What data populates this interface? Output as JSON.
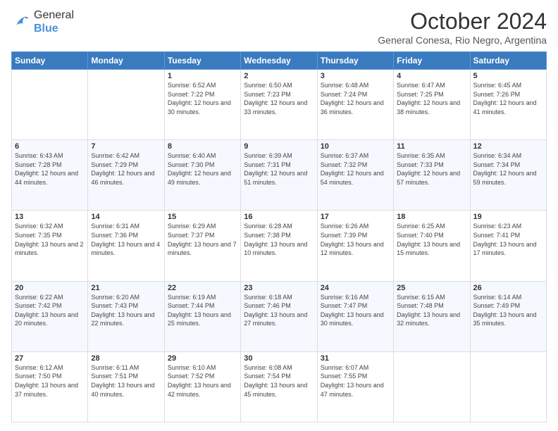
{
  "header": {
    "logo": {
      "general": "General",
      "blue": "Blue"
    },
    "title": "October 2024",
    "subtitle": "General Conesa, Rio Negro, Argentina"
  },
  "days_of_week": [
    "Sunday",
    "Monday",
    "Tuesday",
    "Wednesday",
    "Thursday",
    "Friday",
    "Saturday"
  ],
  "weeks": [
    [
      {
        "day": "",
        "sunrise": "",
        "sunset": "",
        "daylight": ""
      },
      {
        "day": "",
        "sunrise": "",
        "sunset": "",
        "daylight": ""
      },
      {
        "day": "1",
        "sunrise": "Sunrise: 6:52 AM",
        "sunset": "Sunset: 7:22 PM",
        "daylight": "Daylight: 12 hours and 30 minutes."
      },
      {
        "day": "2",
        "sunrise": "Sunrise: 6:50 AM",
        "sunset": "Sunset: 7:23 PM",
        "daylight": "Daylight: 12 hours and 33 minutes."
      },
      {
        "day": "3",
        "sunrise": "Sunrise: 6:48 AM",
        "sunset": "Sunset: 7:24 PM",
        "daylight": "Daylight: 12 hours and 36 minutes."
      },
      {
        "day": "4",
        "sunrise": "Sunrise: 6:47 AM",
        "sunset": "Sunset: 7:25 PM",
        "daylight": "Daylight: 12 hours and 38 minutes."
      },
      {
        "day": "5",
        "sunrise": "Sunrise: 6:45 AM",
        "sunset": "Sunset: 7:26 PM",
        "daylight": "Daylight: 12 hours and 41 minutes."
      }
    ],
    [
      {
        "day": "6",
        "sunrise": "Sunrise: 6:43 AM",
        "sunset": "Sunset: 7:28 PM",
        "daylight": "Daylight: 12 hours and 44 minutes."
      },
      {
        "day": "7",
        "sunrise": "Sunrise: 6:42 AM",
        "sunset": "Sunset: 7:29 PM",
        "daylight": "Daylight: 12 hours and 46 minutes."
      },
      {
        "day": "8",
        "sunrise": "Sunrise: 6:40 AM",
        "sunset": "Sunset: 7:30 PM",
        "daylight": "Daylight: 12 hours and 49 minutes."
      },
      {
        "day": "9",
        "sunrise": "Sunrise: 6:39 AM",
        "sunset": "Sunset: 7:31 PM",
        "daylight": "Daylight: 12 hours and 51 minutes."
      },
      {
        "day": "10",
        "sunrise": "Sunrise: 6:37 AM",
        "sunset": "Sunset: 7:32 PM",
        "daylight": "Daylight: 12 hours and 54 minutes."
      },
      {
        "day": "11",
        "sunrise": "Sunrise: 6:35 AM",
        "sunset": "Sunset: 7:33 PM",
        "daylight": "Daylight: 12 hours and 57 minutes."
      },
      {
        "day": "12",
        "sunrise": "Sunrise: 6:34 AM",
        "sunset": "Sunset: 7:34 PM",
        "daylight": "Daylight: 12 hours and 59 minutes."
      }
    ],
    [
      {
        "day": "13",
        "sunrise": "Sunrise: 6:32 AM",
        "sunset": "Sunset: 7:35 PM",
        "daylight": "Daylight: 13 hours and 2 minutes."
      },
      {
        "day": "14",
        "sunrise": "Sunrise: 6:31 AM",
        "sunset": "Sunset: 7:36 PM",
        "daylight": "Daylight: 13 hours and 4 minutes."
      },
      {
        "day": "15",
        "sunrise": "Sunrise: 6:29 AM",
        "sunset": "Sunset: 7:37 PM",
        "daylight": "Daylight: 13 hours and 7 minutes."
      },
      {
        "day": "16",
        "sunrise": "Sunrise: 6:28 AM",
        "sunset": "Sunset: 7:38 PM",
        "daylight": "Daylight: 13 hours and 10 minutes."
      },
      {
        "day": "17",
        "sunrise": "Sunrise: 6:26 AM",
        "sunset": "Sunset: 7:39 PM",
        "daylight": "Daylight: 13 hours and 12 minutes."
      },
      {
        "day": "18",
        "sunrise": "Sunrise: 6:25 AM",
        "sunset": "Sunset: 7:40 PM",
        "daylight": "Daylight: 13 hours and 15 minutes."
      },
      {
        "day": "19",
        "sunrise": "Sunrise: 6:23 AM",
        "sunset": "Sunset: 7:41 PM",
        "daylight": "Daylight: 13 hours and 17 minutes."
      }
    ],
    [
      {
        "day": "20",
        "sunrise": "Sunrise: 6:22 AM",
        "sunset": "Sunset: 7:42 PM",
        "daylight": "Daylight: 13 hours and 20 minutes."
      },
      {
        "day": "21",
        "sunrise": "Sunrise: 6:20 AM",
        "sunset": "Sunset: 7:43 PM",
        "daylight": "Daylight: 13 hours and 22 minutes."
      },
      {
        "day": "22",
        "sunrise": "Sunrise: 6:19 AM",
        "sunset": "Sunset: 7:44 PM",
        "daylight": "Daylight: 13 hours and 25 minutes."
      },
      {
        "day": "23",
        "sunrise": "Sunrise: 6:18 AM",
        "sunset": "Sunset: 7:46 PM",
        "daylight": "Daylight: 13 hours and 27 minutes."
      },
      {
        "day": "24",
        "sunrise": "Sunrise: 6:16 AM",
        "sunset": "Sunset: 7:47 PM",
        "daylight": "Daylight: 13 hours and 30 minutes."
      },
      {
        "day": "25",
        "sunrise": "Sunrise: 6:15 AM",
        "sunset": "Sunset: 7:48 PM",
        "daylight": "Daylight: 13 hours and 32 minutes."
      },
      {
        "day": "26",
        "sunrise": "Sunrise: 6:14 AM",
        "sunset": "Sunset: 7:49 PM",
        "daylight": "Daylight: 13 hours and 35 minutes."
      }
    ],
    [
      {
        "day": "27",
        "sunrise": "Sunrise: 6:12 AM",
        "sunset": "Sunset: 7:50 PM",
        "daylight": "Daylight: 13 hours and 37 minutes."
      },
      {
        "day": "28",
        "sunrise": "Sunrise: 6:11 AM",
        "sunset": "Sunset: 7:51 PM",
        "daylight": "Daylight: 13 hours and 40 minutes."
      },
      {
        "day": "29",
        "sunrise": "Sunrise: 6:10 AM",
        "sunset": "Sunset: 7:52 PM",
        "daylight": "Daylight: 13 hours and 42 minutes."
      },
      {
        "day": "30",
        "sunrise": "Sunrise: 6:08 AM",
        "sunset": "Sunset: 7:54 PM",
        "daylight": "Daylight: 13 hours and 45 minutes."
      },
      {
        "day": "31",
        "sunrise": "Sunrise: 6:07 AM",
        "sunset": "Sunset: 7:55 PM",
        "daylight": "Daylight: 13 hours and 47 minutes."
      },
      {
        "day": "",
        "sunrise": "",
        "sunset": "",
        "daylight": ""
      },
      {
        "day": "",
        "sunrise": "",
        "sunset": "",
        "daylight": ""
      }
    ]
  ]
}
